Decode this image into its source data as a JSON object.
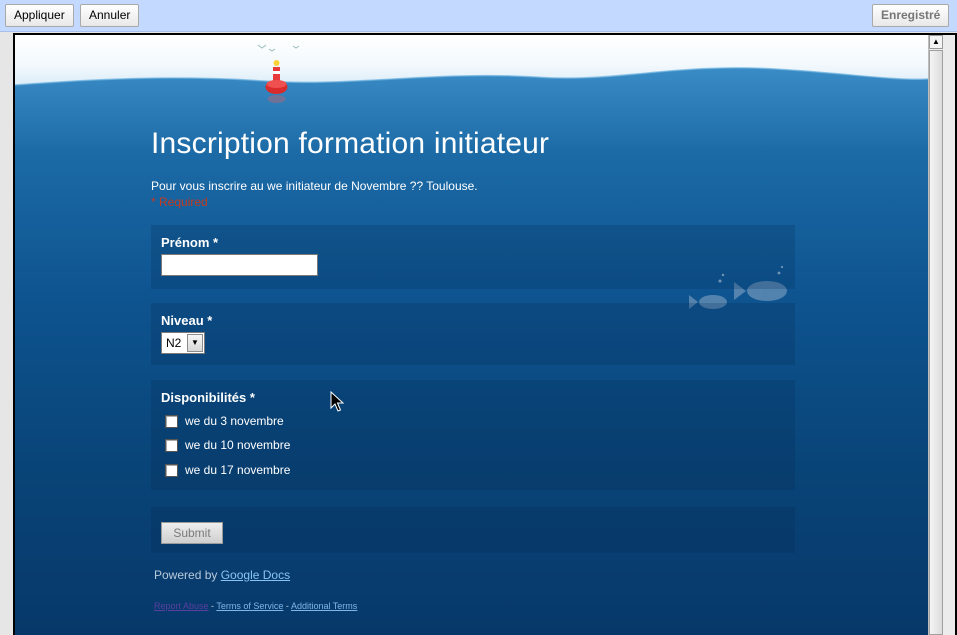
{
  "toolbar": {
    "apply_label": "Appliquer",
    "cancel_label": "Annuler",
    "saved_label": "Enregistré"
  },
  "form": {
    "title": "Inscription formation initiateur",
    "description": "Pour vous inscrire au we initiateur de Novembre ?? Toulouse.",
    "required_note": "* Required",
    "questions": {
      "prenom": {
        "label": "Prénom",
        "star": "*",
        "value": ""
      },
      "niveau": {
        "label": "Niveau",
        "star": "*",
        "selected": "N2"
      },
      "dispo": {
        "label": "Disponibilités",
        "star": "*",
        "options": [
          "we du 3 novembre",
          "we du 10 novembre",
          "we du 17 novembre"
        ]
      }
    },
    "submit_label": "Submit"
  },
  "footer": {
    "powered_prefix": "Powered by",
    "powered_link": "Google Docs",
    "report_abuse": "Report Abuse",
    "sep1": " - ",
    "terms": "Terms of Service",
    "sep2": " - ",
    "additional": "Additional Terms"
  },
  "colors": {
    "toolbar_bg": "#c3d9ff",
    "sea_dark": "#07386a",
    "required_red": "#c43a1f",
    "link_blue": "#88c4f0"
  },
  "icons": {
    "dropdown": "chevron-down-icon",
    "scroll_up": "arrow-up-icon",
    "cursor": "mouse-pointer-icon"
  }
}
